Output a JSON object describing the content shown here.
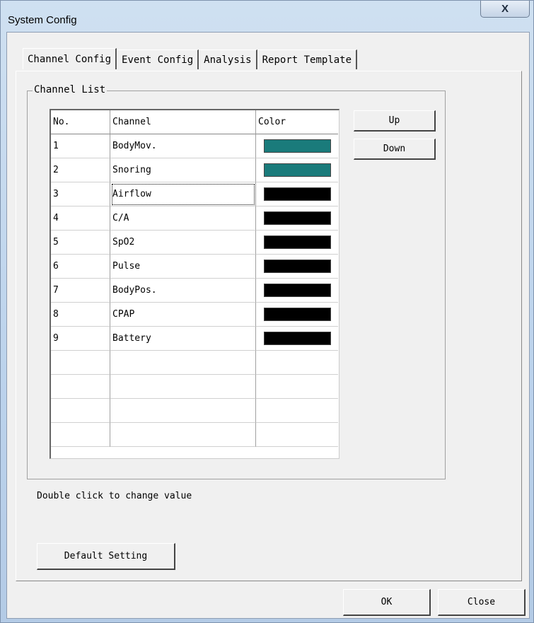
{
  "window": {
    "title": "System Config",
    "close_symbol": "X"
  },
  "tabs": [
    {
      "label": "Channel Config",
      "active": true
    },
    {
      "label": "Event Config",
      "active": false
    },
    {
      "label": "Analysis",
      "active": false
    },
    {
      "label": "Report Template",
      "active": false
    }
  ],
  "channel_list": {
    "group_label": "Channel List",
    "headers": {
      "no": "No.",
      "channel": "Channel",
      "color": "Color"
    },
    "rows": [
      {
        "no": "1",
        "channel": "BodyMov.",
        "color": "#1a7b7b"
      },
      {
        "no": "2",
        "channel": "Snoring",
        "color": "#1a7b7b"
      },
      {
        "no": "3",
        "channel": "Airflow",
        "color": "#000000",
        "focused": true
      },
      {
        "no": "4",
        "channel": "C/A",
        "color": "#000000"
      },
      {
        "no": "5",
        "channel": "SpO2",
        "color": "#000000"
      },
      {
        "no": "6",
        "channel": "Pulse",
        "color": "#000000"
      },
      {
        "no": "7",
        "channel": "BodyPos.",
        "color": "#000000"
      },
      {
        "no": "8",
        "channel": "CPAP",
        "color": "#000000"
      },
      {
        "no": "9",
        "channel": "Battery",
        "color": "#000000"
      }
    ],
    "empty_rows": 4
  },
  "buttons": {
    "up": "Up",
    "down": "Down",
    "default_setting": "Default Setting",
    "ok": "OK",
    "close": "Close"
  },
  "hint": "Double click to change value"
}
